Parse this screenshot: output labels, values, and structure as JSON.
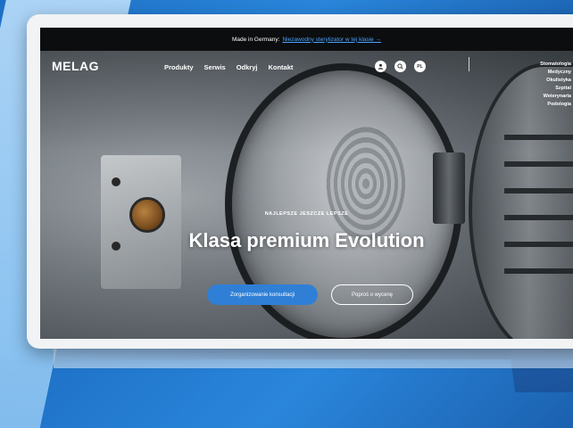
{
  "topbar": {
    "text": "Made in Germany:",
    "link": "Niezawodny sterylizator w tej klasie →"
  },
  "brand": {
    "logo": "MELAG"
  },
  "nav": {
    "items": [
      "Produkty",
      "Serwis",
      "Odkryj",
      "Kontakt"
    ],
    "icons": [
      {
        "name": "user-icon",
        "glyph": "◉"
      },
      {
        "name": "search-icon",
        "glyph": "⌕"
      },
      {
        "name": "language-icon",
        "glyph": "PL"
      }
    ]
  },
  "side_menu": [
    "Stomatologia",
    "Medyczny",
    "Okulistyka",
    "Szpital",
    "Weterynaria",
    "Podologia"
  ],
  "hero": {
    "kicker": "NAJLEPSZE JESZCZE LEPSZE",
    "title": "Klasa premium Evolution",
    "primary_button": "Zorganizowanie konsultacji",
    "secondary_button": "Poproś o wycenę"
  },
  "colors": {
    "accent": "#2f7fd6",
    "topbar": "#0c0d0e",
    "link": "#4aa3ff"
  }
}
